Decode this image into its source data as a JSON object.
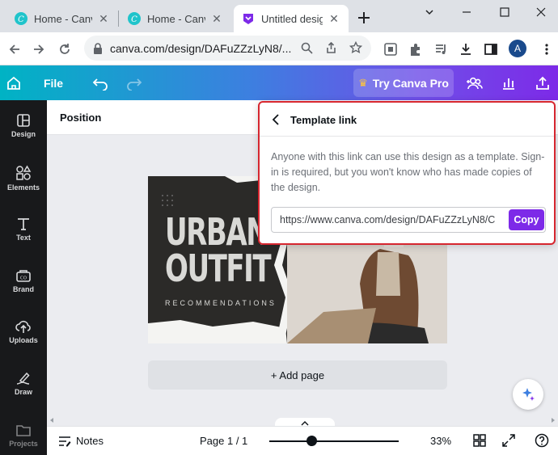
{
  "browser": {
    "tabs": [
      {
        "title": "Home - Canva",
        "active": false
      },
      {
        "title": "Home - Canva",
        "active": false
      },
      {
        "title": "Untitled design",
        "active": true
      }
    ],
    "url": "canva.com/design/DAFuZZzLyN8/...",
    "profile_initial": "A"
  },
  "canva_header": {
    "file_label": "File",
    "try_pro_label": "Try Canva Pro",
    "gradient_start": "#00b3c4",
    "gradient_end": "#7d2ae8"
  },
  "sidebar": {
    "items": [
      {
        "label": "Design",
        "icon": "design-icon"
      },
      {
        "label": "Elements",
        "icon": "elements-icon"
      },
      {
        "label": "Text",
        "icon": "text-icon"
      },
      {
        "label": "Brand",
        "icon": "brand-icon"
      },
      {
        "label": "Uploads",
        "icon": "uploads-icon"
      },
      {
        "label": "Draw",
        "icon": "draw-icon"
      },
      {
        "label": "Projects",
        "icon": "projects-icon"
      }
    ]
  },
  "toolbar": {
    "position_label": "Position"
  },
  "design": {
    "headline_line1": "URBAN",
    "headline_line2": "OUTFIT",
    "subheading": "RECOMMENDATIONS"
  },
  "workspace": {
    "add_page_label": "+ Add page"
  },
  "footer": {
    "notes_label": "Notes",
    "page_indicator": "Page 1 / 1",
    "zoom": "33%",
    "zoom_fraction": 0.33
  },
  "template_popup": {
    "title": "Template link",
    "description": "Anyone with this link can use this design as a template. Sign-in is required, but you won't know who has made copies of the design.",
    "link_value": "https://www.canva.com/design/DAFuZZzLyN8/C",
    "copy_label": "Copy",
    "highlight_color": "#d6262f",
    "button_color": "#7d2ae8"
  }
}
